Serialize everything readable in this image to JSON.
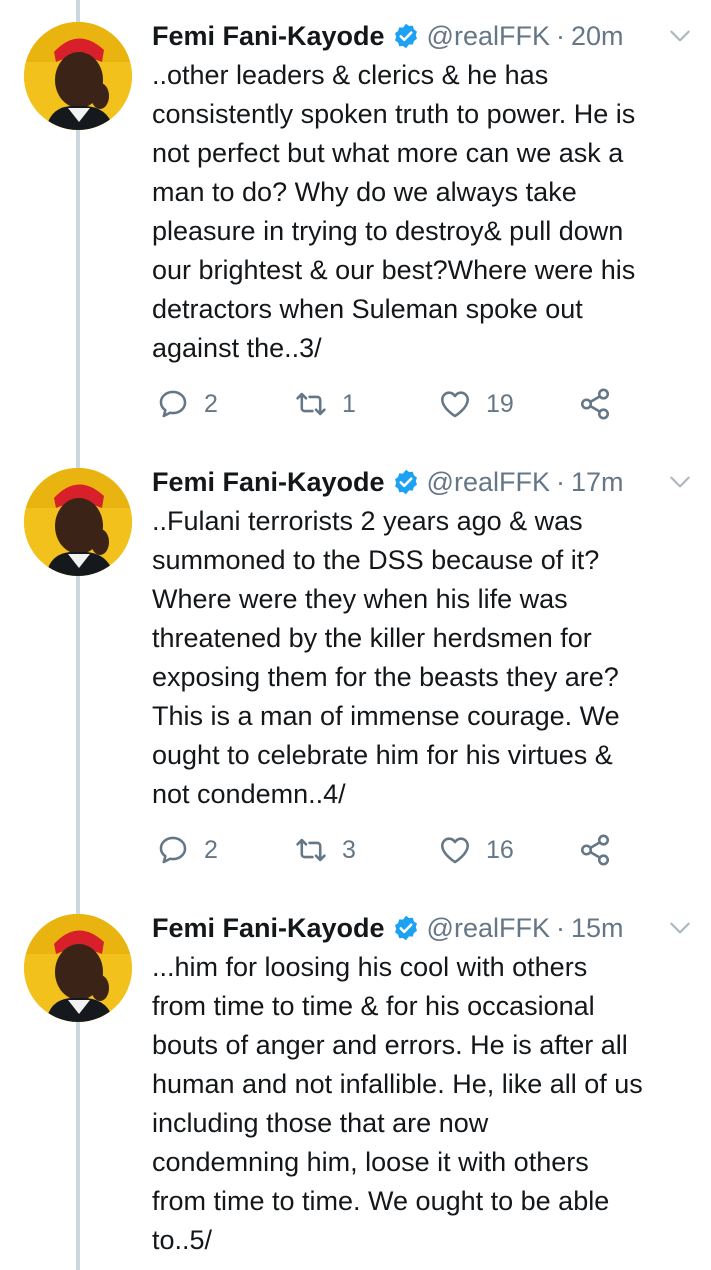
{
  "tweets": [
    {
      "name": "Femi Fani-Kayode",
      "handle": "@realFFK",
      "separator": "·",
      "time": "20m",
      "text": "..other leaders & clerics & he has\nconsistently spoken truth to power. He is\nnot perfect but what more can we ask a\nman to do? Why do we always take\npleasure in trying to destroy& pull down\nour brightest & our best?Where were his\ndetractors when Suleman spoke out\nagainst the..3/",
      "replies": "2",
      "retweets": "1",
      "likes": "19"
    },
    {
      "name": "Femi Fani-Kayode",
      "handle": "@realFFK",
      "separator": "·",
      "time": "17m",
      "text": "..Fulani terrorists 2 years ago & was\nsummoned to the DSS because of it?\nWhere were they when his life was\nthreatened by the killer herdsmen for\nexposing them for the beasts they are?\nThis is a man of immense courage. We\nought to celebrate him for his virtues &\nnot condemn..4/",
      "replies": "2",
      "retweets": "3",
      "likes": "16"
    },
    {
      "name": "Femi Fani-Kayode",
      "handle": "@realFFK",
      "separator": "·",
      "time": "15m",
      "text": "...him for loosing his cool with others\nfrom time to time & for his occasional\nbouts of anger and errors. He is after all\nhuman and not infallible. He, like all of us\nincluding those that are now\ncondemning him, loose it with others\nfrom time to time. We ought to be able\nto..5/"
    }
  ],
  "icons": {
    "reply": "speech-bubble-icon",
    "retweet": "retweet-arrows-icon",
    "like": "heart-icon",
    "share": "share-nodes-icon",
    "verified": "verified-badge-icon",
    "caret": "chevron-down-icon"
  },
  "colors": {
    "text": "#14171a",
    "secondary": "#657786",
    "verified": "#1da1f2",
    "thread_line": "#ccd6dd"
  }
}
